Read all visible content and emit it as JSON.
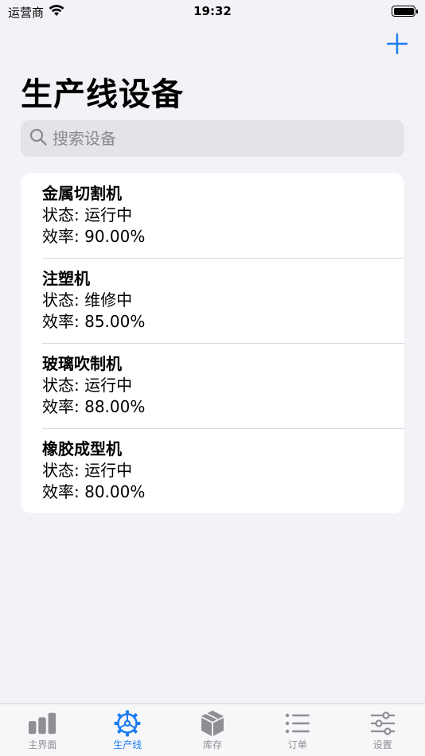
{
  "status_bar": {
    "carrier": "运营商",
    "time": "19:32"
  },
  "header": {
    "title": "生产线设备",
    "add_icon": "plus-icon"
  },
  "search": {
    "placeholder": "搜索设备",
    "value": ""
  },
  "equipment": [
    {
      "name": "金属切割机",
      "status": "状态: 运行中",
      "efficiency": "效率: 90.00%"
    },
    {
      "name": "注塑机",
      "status": "状态: 维修中",
      "efficiency": "效率: 85.00%"
    },
    {
      "name": "玻璃吹制机",
      "status": "状态: 运行中",
      "efficiency": "效率: 88.00%"
    },
    {
      "name": "橡胶成型机",
      "status": "状态: 运行中",
      "efficiency": "效率: 80.00%"
    }
  ],
  "tabs": [
    {
      "label": "主界面",
      "icon": "bar-chart-icon",
      "active": false
    },
    {
      "label": "生产线",
      "icon": "gear-icon",
      "active": true
    },
    {
      "label": "库存",
      "icon": "box-icon",
      "active": false
    },
    {
      "label": "订单",
      "icon": "list-icon",
      "active": false
    },
    {
      "label": "设置",
      "icon": "sliders-icon",
      "active": false
    }
  ],
  "colors": {
    "accent": "#1a7cf2",
    "background": "#f2f2f7",
    "inactive": "#8e8e93"
  }
}
